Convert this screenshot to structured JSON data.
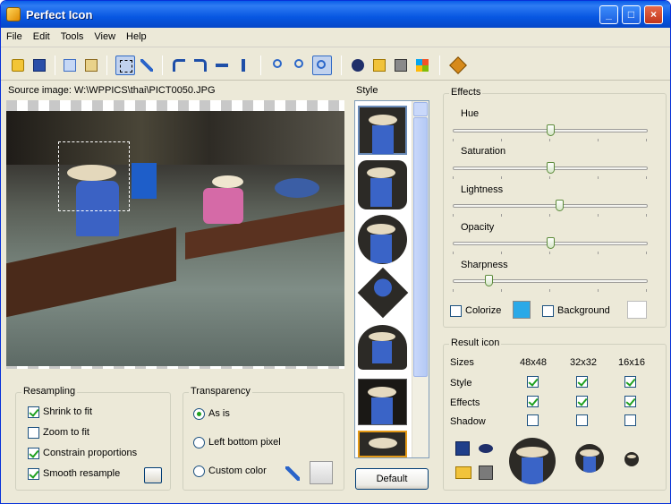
{
  "window": {
    "title": "Perfect Icon",
    "minimize": "_",
    "maximize": "□",
    "close": "×"
  },
  "menu": [
    "File",
    "Edit",
    "Tools",
    "View",
    "Help"
  ],
  "toolbar_icons": [
    "open-icon",
    "save-icon",
    "copy-icon",
    "paste-icon",
    "select-icon",
    "pick-color-icon",
    "rotate-left-icon",
    "rotate-right-icon",
    "flip-horizontal-icon",
    "flip-vertical-icon",
    "zoom-in-icon",
    "zoom-out-icon",
    "zoom-fit-icon",
    "preview-icon",
    "open-folder-icon",
    "print-icon",
    "windows-icon",
    "settings-icon"
  ],
  "source": {
    "label": "Source image: W:\\WPPICS\\thai\\PICT0050.JPG"
  },
  "style": {
    "label": "Style",
    "items": [
      "square",
      "rounded-square",
      "circle",
      "diamond",
      "heart",
      "square-dark",
      "square-selected"
    ],
    "selected_index": 6
  },
  "default_button": "Default",
  "effects": {
    "label": "Effects",
    "sliders": [
      {
        "name": "Hue",
        "value": 0.5
      },
      {
        "name": "Saturation",
        "value": 0.5
      },
      {
        "name": "Lightness",
        "value": 0.55
      },
      {
        "name": "Opacity",
        "value": 0.5
      },
      {
        "name": "Sharpness",
        "value": 0.17
      }
    ],
    "colorize": {
      "label": "Colorize",
      "checked": false,
      "color": "#2aa9e8"
    },
    "background": {
      "label": "Background",
      "checked": false,
      "color": "#ffffff"
    }
  },
  "result": {
    "label": "Result icon",
    "sizes_label": "Sizes",
    "sizes": [
      "48x48",
      "32x32",
      "16x16"
    ],
    "rows": [
      {
        "label": "Style",
        "checks": [
          true,
          true,
          true
        ]
      },
      {
        "label": "Effects",
        "checks": [
          true,
          true,
          true
        ]
      },
      {
        "label": "Shadow",
        "checks": [
          false,
          false,
          false
        ]
      }
    ]
  },
  "resampling": {
    "label": "Resampling",
    "options": [
      {
        "label": "Shrink to fit",
        "checked": true
      },
      {
        "label": "Zoom to fit",
        "checked": false
      },
      {
        "label": "Constrain proportions",
        "checked": true
      },
      {
        "label": "Smooth resample",
        "checked": true
      }
    ]
  },
  "transparency": {
    "label": "Transparency",
    "options": [
      {
        "label": "As is",
        "selected": true
      },
      {
        "label": "Left bottom pixel",
        "selected": false
      },
      {
        "label": "Custom color",
        "selected": false
      }
    ]
  }
}
